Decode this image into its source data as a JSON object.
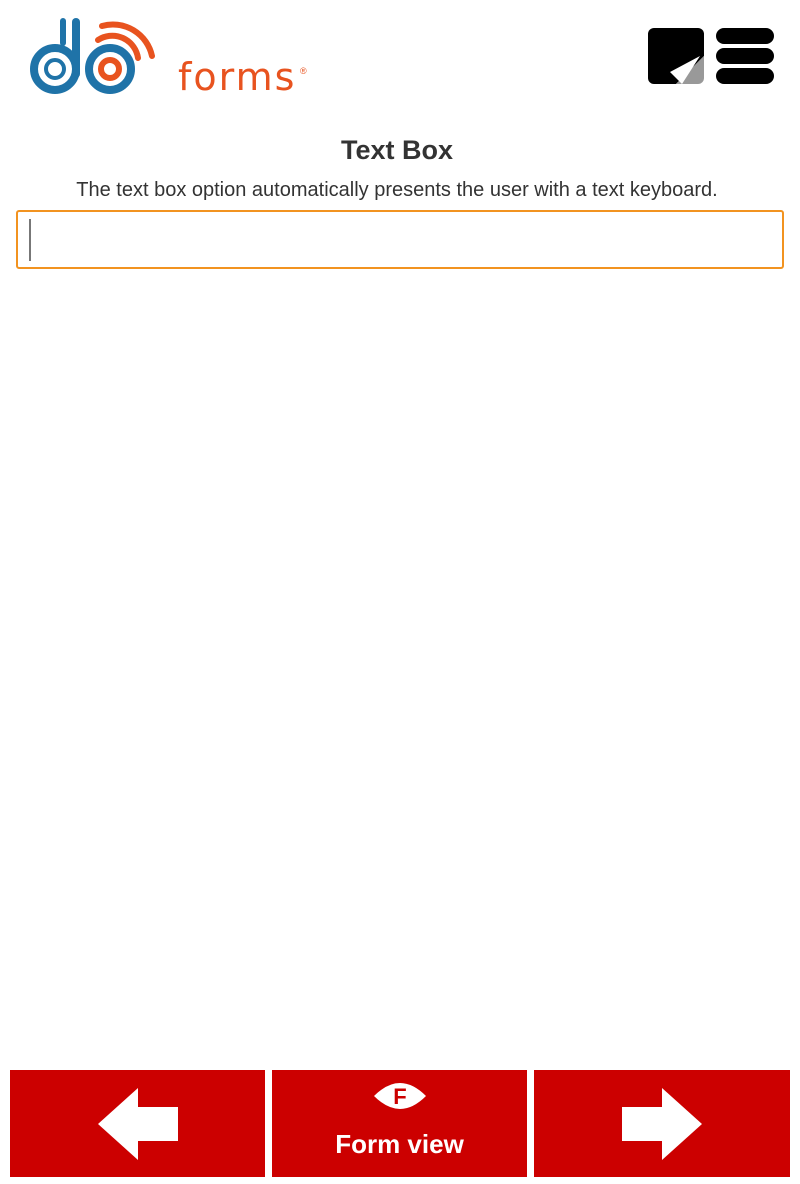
{
  "app": {
    "logo_text": "forms",
    "logo_mark": "®"
  },
  "header": {
    "note_icon": "sticky-note-icon",
    "menu_icon": "menu-icon"
  },
  "question": {
    "title": "Text Box",
    "description": "The text box option automatically presents the user with a text keyboard.",
    "value": "",
    "placeholder": ""
  },
  "nav": {
    "prev_icon": "arrow-left-icon",
    "form_icon": "form-eye-icon",
    "form_icon_letter": "F",
    "form_label": "Form view",
    "next_icon": "arrow-right-icon"
  },
  "colors": {
    "brand_blue": "#1f73a8",
    "brand_orange": "#e8531f",
    "input_border": "#f29320",
    "nav_red": "#cc0000"
  }
}
